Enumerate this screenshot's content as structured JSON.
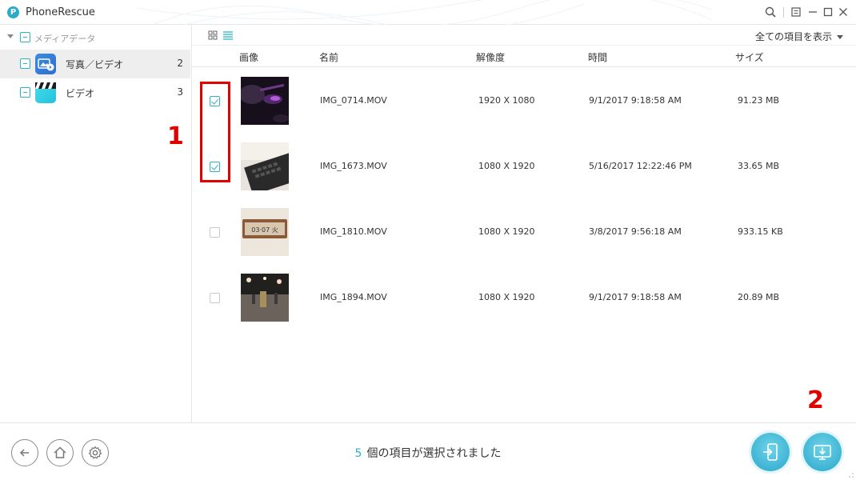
{
  "app": {
    "title": "PhoneRescue"
  },
  "sidebar": {
    "root": {
      "label": "メディアデータ"
    },
    "items": [
      {
        "label": "写真／ビデオ",
        "count": "2",
        "icon": "photo-video-icon",
        "color": "#3a8be0"
      },
      {
        "label": "ビデオ",
        "count": "3",
        "icon": "clapper-icon",
        "color": "#2ad0e6"
      }
    ]
  },
  "toolbar": {
    "show_all": "全ての項目を表示"
  },
  "columns": {
    "image": "画像",
    "name": "名前",
    "resolution": "解像度",
    "time": "時間",
    "size": "サイズ"
  },
  "rows": [
    {
      "checked": true,
      "name": "IMG_0714.MOV",
      "resolution": "1920 X 1080",
      "time": "9/1/2017 9:18:58 AM",
      "size": "91.23 MB"
    },
    {
      "checked": true,
      "name": "IMG_1673.MOV",
      "resolution": "1080 X 1920",
      "time": "5/16/2017 12:22:46 PM",
      "size": "33.65 MB"
    },
    {
      "checked": false,
      "name": "IMG_1810.MOV",
      "resolution": "1080 X 1920",
      "time": "3/8/2017 9:56:18 AM",
      "size": "933.15 KB"
    },
    {
      "checked": false,
      "name": "IMG_1894.MOV",
      "resolution": "1080 X 1920",
      "time": "9/1/2017 9:18:58 AM",
      "size": "20.89 MB"
    }
  ],
  "thumb_texts": {
    "row3": "03·07 火"
  },
  "annotations": {
    "marker1": "1",
    "marker2": "2",
    "color": "#e00000"
  },
  "footer": {
    "selected_count": "5",
    "selected_text": "個の項目が選択されました"
  },
  "colors": {
    "accent": "#2bb3c7",
    "button": "#2aa7cc"
  }
}
